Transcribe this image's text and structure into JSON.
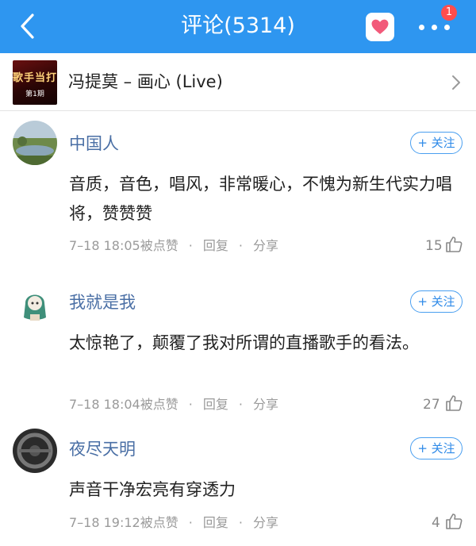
{
  "header": {
    "title": "评论(5314)",
    "badge_count": "1",
    "background_color": "#2e96f0"
  },
  "song": {
    "name": "冯提莫 – 画心 (Live)",
    "cover_title": "歌手当打",
    "cover_sub": "第1期"
  },
  "comments": [
    {
      "username": "中国人",
      "follow_label": "+ 关注",
      "content": "音质，音色，唱风，非常暖心，不愧为新生代实力唱将，赞赞赞",
      "time": "7–18 18:05",
      "liked_label": "被点赞",
      "reply_label": "回复",
      "share_label": "分享",
      "likes": "15"
    },
    {
      "username": "我就是我",
      "follow_label": "+ 关注",
      "content": "太惊艳了，颠覆了我对所谓的直播歌手的看法。",
      "time": "7–18 18:04",
      "liked_label": "被点赞",
      "reply_label": "回复",
      "share_label": "分享",
      "likes": "27"
    },
    {
      "username": "夜尽天明",
      "follow_label": "+ 关注",
      "content": "声音干净宏亮有穿透力",
      "time": "7–18 19:12",
      "liked_label": "被点赞",
      "reply_label": "回复",
      "share_label": "分享",
      "likes": "4"
    }
  ]
}
